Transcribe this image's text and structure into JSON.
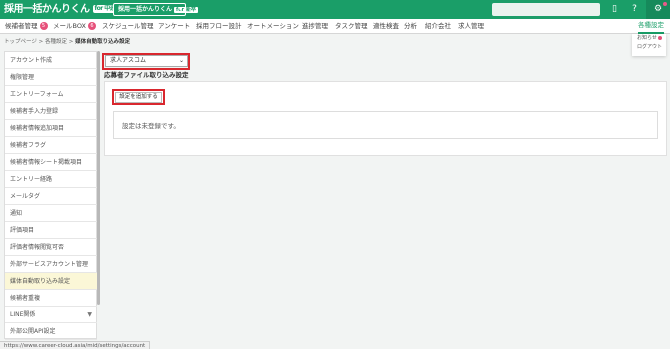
{
  "header": {
    "logo_text": "採用一括かんりくん",
    "logo_badge": "for 中途",
    "product_switch": "採用一括かんりくん",
    "product_tag": "for 新卒",
    "search_placeholder": "",
    "icons": [
      "book-icon",
      "help-icon",
      "gear-icon"
    ]
  },
  "nav": {
    "items": [
      {
        "label": "候補者管理",
        "badge": "5"
      },
      {
        "label": "メールBOX",
        "badge": "6"
      },
      {
        "label": "スケジュール管理"
      },
      {
        "label": "アンケート"
      },
      {
        "label": "採用フロー設計"
      },
      {
        "label": "オートメーション"
      },
      {
        "label": "進捗管理"
      },
      {
        "label": "タスク管理"
      },
      {
        "label": "適性検査"
      },
      {
        "label": "分析"
      },
      {
        "label": "紹介会社"
      },
      {
        "label": "求人管理"
      }
    ],
    "settings": "各種設定"
  },
  "user_menu": {
    "items": [
      "お知らせ",
      "ログアウト"
    ]
  },
  "breadcrumb": {
    "top": "トップページ",
    "sep": ">",
    "settings": "各種設定",
    "current": "媒体自動取り込み設定"
  },
  "sidebar": {
    "items": [
      "アカウント作成",
      "権限管理",
      "エントリーフォーム",
      "候補者手入力登録",
      "候補者情報追加項目",
      "候補者フラグ",
      "候補者情報シート掲載項目",
      "エントリー経路",
      "メールタグ",
      "通知",
      "評価項目",
      "評価者情報閲覧可否",
      "外部サービスアカウント管理",
      "媒体自動取り込み設定",
      "候補者重複",
      "LINE関係",
      "外部公開API設定"
    ],
    "active": "媒体自動取り込み設定"
  },
  "main": {
    "media_select": "求人アスコム",
    "section_title": "応募者ファイル取り込み設定",
    "add_button": "設定を追加する",
    "empty_message": "設定は未登録です。"
  },
  "status_bar": {
    "url": "https://www.career-cloud.asia/mid/settings/account"
  },
  "colors": {
    "brand": "#1a9e68",
    "highlight": "#d9272e",
    "badge": "#e6507a",
    "active_row": "#fbf7d7"
  }
}
